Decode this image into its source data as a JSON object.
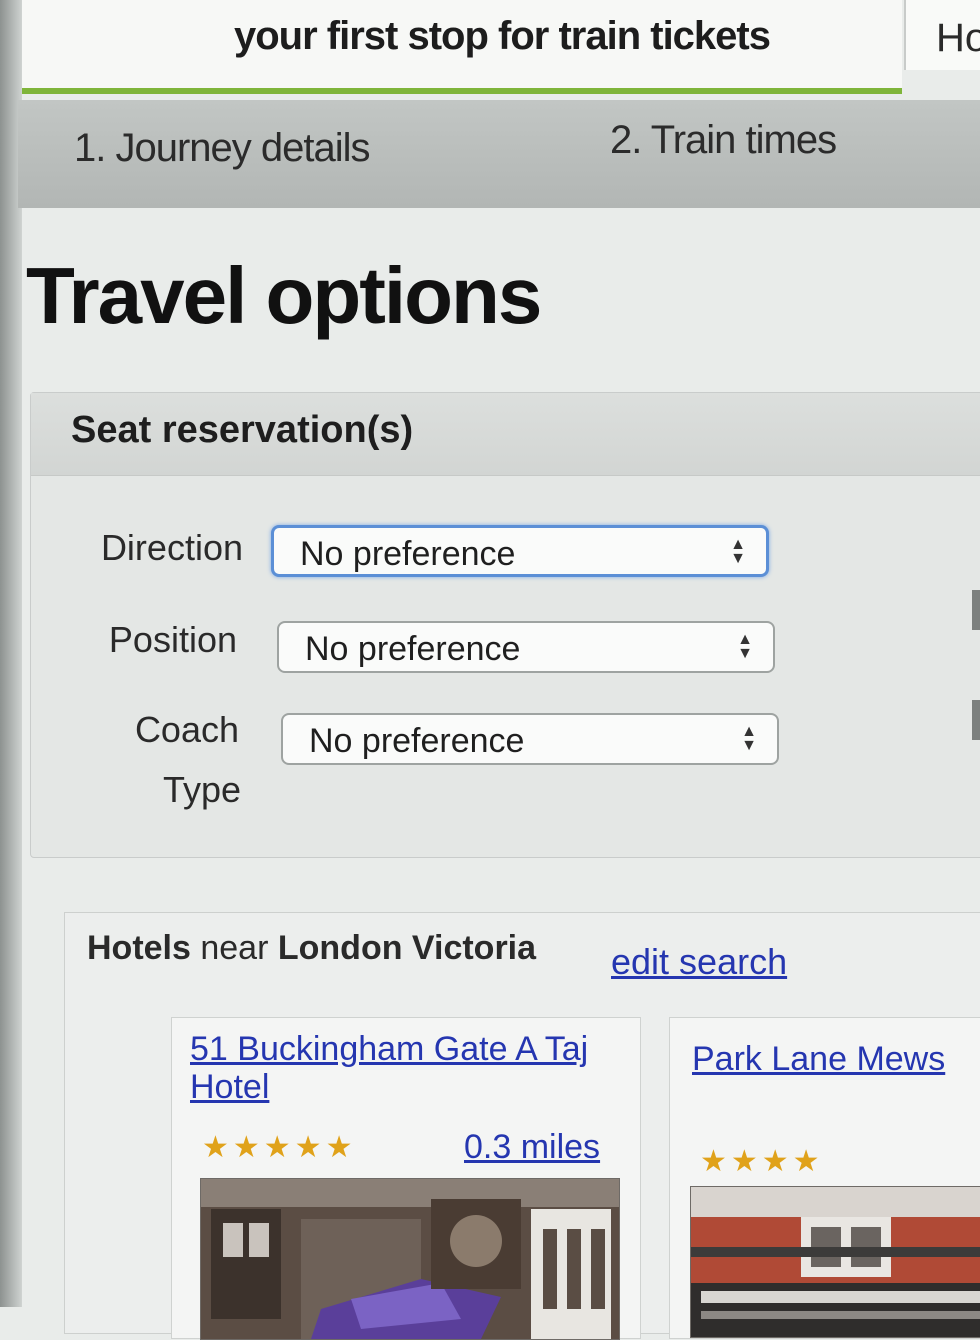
{
  "header": {
    "tagline": "your first stop for train tickets",
    "home_tab_partial": "Ho"
  },
  "steps": {
    "step1": "1. Journey details",
    "step2": "2. Train times"
  },
  "page": {
    "title": "Travel options"
  },
  "seat_reservation": {
    "title": "Seat reservation(s)",
    "fields": [
      {
        "label": "Direction",
        "value": "No preference"
      },
      {
        "label": "Position",
        "value": "No preference"
      },
      {
        "label_line1": "Coach",
        "label_line2": "Type",
        "value": "No preference"
      }
    ]
  },
  "hotels": {
    "heading_bold1": "Hotels",
    "heading_near": " near ",
    "heading_bold2": "London Victoria",
    "edit_link": "edit search",
    "cards": [
      {
        "name": "51 Buckingham Gate A Taj Hotel",
        "stars": "★★★★★",
        "distance": "0.3 miles"
      },
      {
        "name": "Park Lane Mews",
        "stars": "★★★★"
      }
    ]
  },
  "colors": {
    "accent_green": "#7fb53a",
    "link_blue": "#2536b0",
    "star_gold": "#e0a21a",
    "focus_blue": "#5b8fd6"
  }
}
